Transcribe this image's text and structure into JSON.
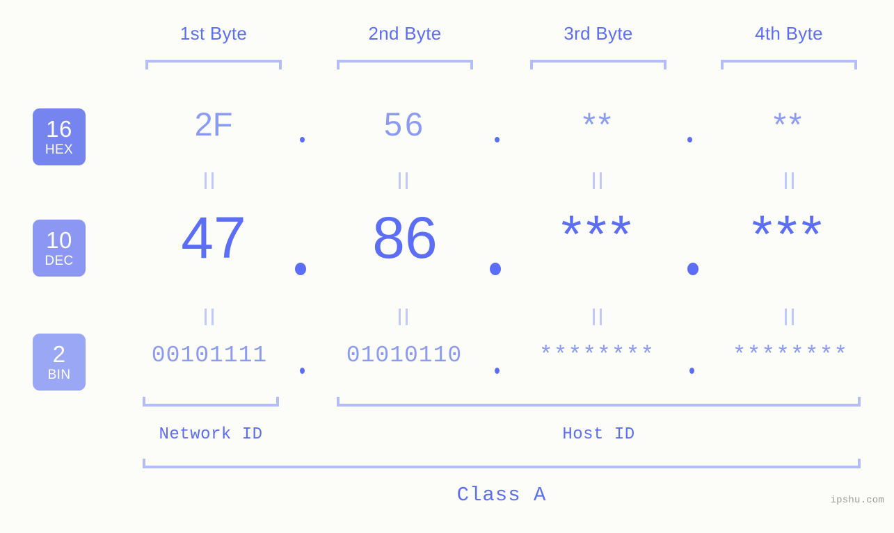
{
  "meta": {
    "watermark": "ipshu.com",
    "background_color": "#fcfdf9",
    "accent_color": "#5b6ef5",
    "accent_light_color": "#8c9bf2",
    "bracket_color": "#b3bdf8"
  },
  "byte_headers": [
    {
      "label": "1st Byte"
    },
    {
      "label": "2nd Byte"
    },
    {
      "label": "3rd Byte"
    },
    {
      "label": "4th Byte"
    }
  ],
  "rows": [
    {
      "key": "hex",
      "badge": {
        "number": "16",
        "abbr": "HEX",
        "color": "#7684ef"
      },
      "values": [
        "2F",
        "56",
        "**",
        "**"
      ],
      "separator": "."
    },
    {
      "key": "dec",
      "badge": {
        "number": "10",
        "abbr": "DEC",
        "color": "#8b97f2"
      },
      "values": [
        "47",
        "86",
        "***",
        "***"
      ],
      "separator": "."
    },
    {
      "key": "bin",
      "badge": {
        "number": "2",
        "abbr": "BIN",
        "color": "#9aa7f5"
      },
      "values": [
        "00101111",
        "01010110",
        "********",
        "********"
      ],
      "separator": "."
    }
  ],
  "equality_marks": {
    "symbol": "||",
    "count_top": 4,
    "count_bottom": 4
  },
  "id_sections": [
    {
      "label": "Network ID"
    },
    {
      "label": "Host ID"
    }
  ],
  "class_section": {
    "label": "Class A"
  }
}
